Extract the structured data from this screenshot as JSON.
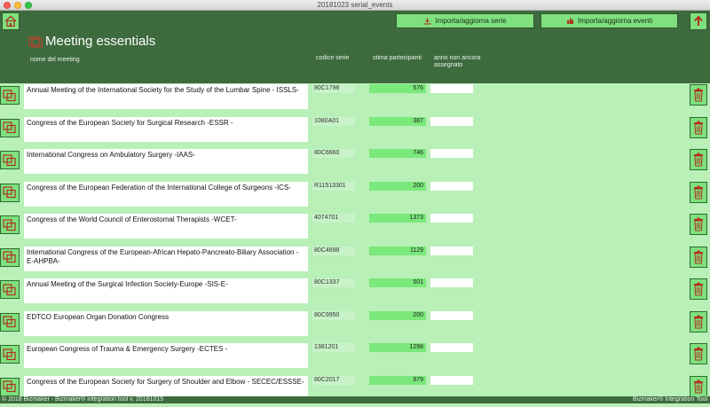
{
  "window": {
    "title": "20181023 serial_events"
  },
  "toolbar": {
    "import_series_label": "Importa/aggiorna serie",
    "import_events_label": "Importa/aggiorna eventi"
  },
  "page": {
    "title": "Meeting essentials"
  },
  "columns": {
    "name": "nome del meeting",
    "code": "codice serie",
    "estimate": "stima partecipanti",
    "unassigned_line1": "anno non ancora",
    "unassigned_line2": "assegnato"
  },
  "rows": [
    {
      "name": "Annual Meeting of the International Society for the Study of the Lumbar Spine - ISSLS-",
      "code": "80C1798",
      "estimate": "576"
    },
    {
      "name": "Congress of the European Society for Surgical Research -ESSR -",
      "code": "1080A01",
      "estimate": "387"
    },
    {
      "name": "International Congress on Ambulatory Surgery -IAAS-",
      "code": "80C6660",
      "estimate": "746"
    },
    {
      "name": "Congress of the European Federation of the International College of Surgeons -ICS-",
      "code": "R11513301",
      "estimate": "200"
    },
    {
      "name": "Congress of the World Council of Enterostomal Therapists -WCET-",
      "code": "4074701",
      "estimate": "1373"
    },
    {
      "name": "International Congress of the European-African Hepato-Pancreato-Biliary Association -E-AHPBA-",
      "code": "80C4898",
      "estimate": "1129"
    },
    {
      "name": "Annual Meeting of the Surgical Infection Society-Europe -SIS-E-",
      "code": "80C1337",
      "estimate": "501"
    },
    {
      "name": "EDTCO European Organ Donation Congress",
      "code": "80C9950",
      "estimate": "200"
    },
    {
      "name": "European Congress of Trauma & Emergency Surgery -ECTES -",
      "code": "1381201",
      "estimate": "1298"
    },
    {
      "name": "Congress of the European Society for Surgery of Shoulder and Elbow - SECEC/ESSSE-",
      "code": "80C2017",
      "estimate": "979"
    }
  ],
  "status": {
    "left": "© 2018 Bizmaker - Bizmaker® integration tool v. 20181015",
    "right": "Bizmaker® Integration Tool"
  }
}
